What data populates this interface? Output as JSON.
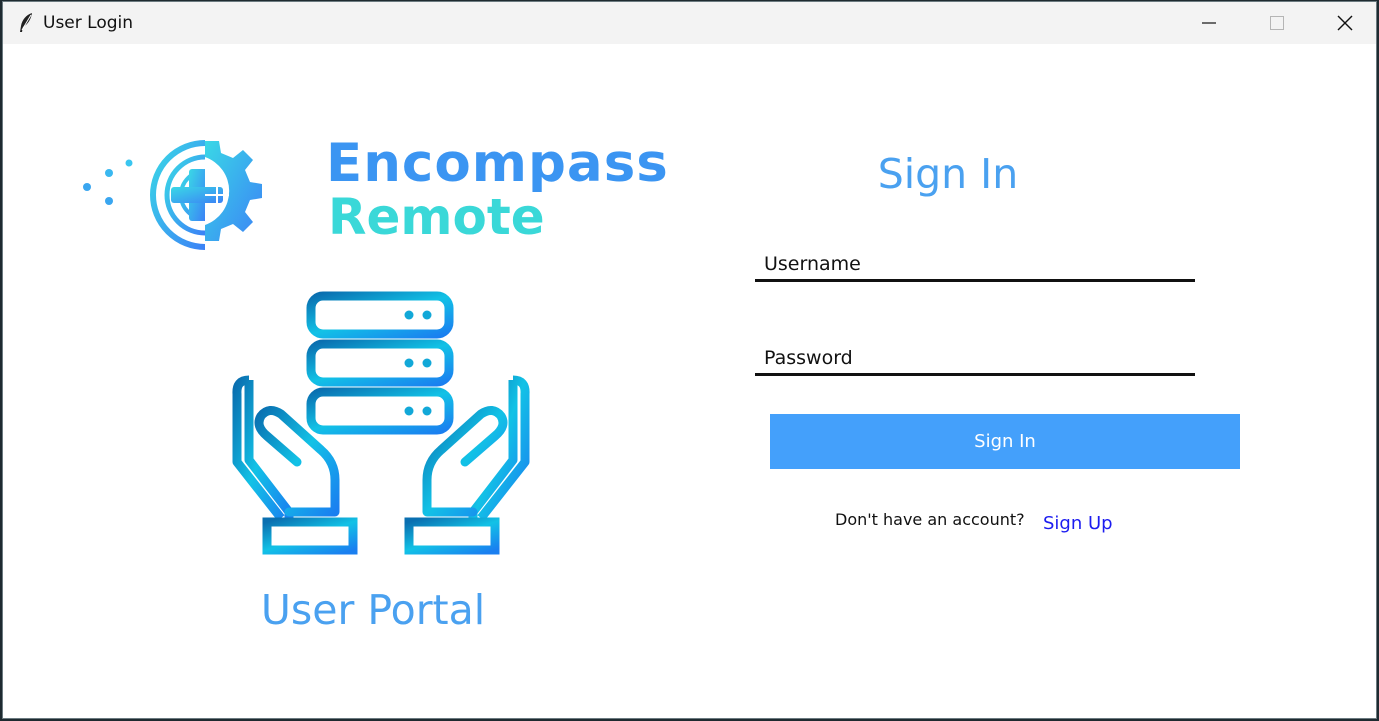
{
  "window": {
    "title": "User Login",
    "icon": "feather-icon",
    "controls": {
      "minimize_icon": "minimize-icon",
      "maximize_icon": "maximize-icon",
      "close_icon": "close-icon"
    }
  },
  "branding": {
    "logo_icon": "medical-gear-circuit-logo-icon",
    "line1": "Encompass",
    "line2": "Remote",
    "colors": {
      "blue": "#3b95f2",
      "cyan": "#3ad8d8"
    }
  },
  "illustration": {
    "icon": "hands-holding-server-icon"
  },
  "portal": {
    "label": "User Portal"
  },
  "signin": {
    "title": "Sign In",
    "username_placeholder": "Username",
    "password_placeholder": "Password",
    "button_label": "Sign In",
    "no_account_text": "Don't have an account?",
    "signup_label": "Sign Up"
  },
  "colors": {
    "accent": "#44a0fb",
    "title_blue": "#4aa1f0",
    "link": "#1c1cf0"
  }
}
